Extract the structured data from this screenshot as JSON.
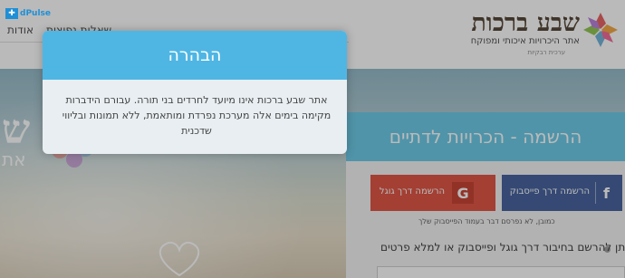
{
  "watermark": {
    "text": "dPulse"
  },
  "header": {
    "logo_title": "שבע ברכות",
    "logo_subtitle": "אתר היכרויות איכותי ומפוקח",
    "logo_tagline": "ערכית רבקיות",
    "nav_items": [
      "אודות",
      "שאלות נפוצות"
    ]
  },
  "hero": {
    "big_text": "ש",
    "big_sub": "את"
  },
  "register": {
    "title": "הרשמה - הכרויות לדתיים",
    "facebook_label": "הרשמה דרך פייסבוק",
    "google_label": "הרשמה דרך גוגל",
    "facebook_icon": "facebook-f-icon",
    "google_icon": "google-g-icon",
    "note": "כמובן, לא נפרסם דבר בעמוד הפייסבוק שלך",
    "info_line": "ניתן להרשם בחיבור דרך גוגל ופייסבוק או למלא פרטים"
  },
  "modal": {
    "title": "הבהרה",
    "body": "אתר שבע ברכות אינו מיועד לחרדים בני תורה. עבורם הידברות מקימה בימים אלה מערכת נפרדת ומותאמת, ללא תמונות ובליווי שדכנית"
  },
  "colors": {
    "modal_header": "#4fb6e4",
    "panel_header": "#63c7e6",
    "facebook": "#3b5998",
    "google": "#dd4b39"
  }
}
